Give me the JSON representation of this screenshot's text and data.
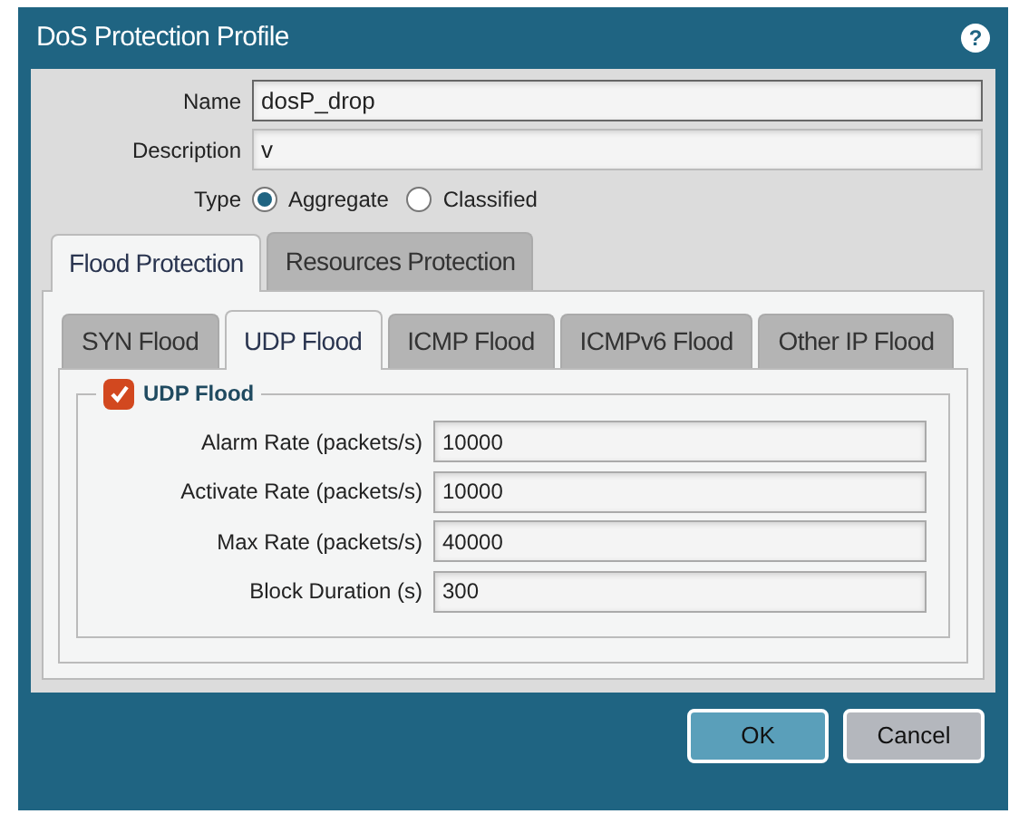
{
  "window": {
    "title": "DoS Protection Profile",
    "help": "?"
  },
  "fields": [
    {
      "label": "Name",
      "value": "dosP_drop",
      "focused": true
    },
    {
      "label": "Description",
      "value": "v",
      "focused": false
    }
  ],
  "type": {
    "label": "Type",
    "options": [
      {
        "label": "Aggregate",
        "selected": true
      },
      {
        "label": "Classified",
        "selected": false
      }
    ]
  },
  "tabs": [
    {
      "label": "Flood Protection",
      "selected": true
    },
    {
      "label": "Resources Protection",
      "selected": false
    }
  ],
  "subtabs": [
    {
      "label": "SYN Flood",
      "selected": false
    },
    {
      "label": "UDP Flood",
      "selected": true
    },
    {
      "label": "ICMP Flood",
      "selected": false
    },
    {
      "label": "ICMPv6 Flood",
      "selected": false
    },
    {
      "label": "Other IP Flood",
      "selected": false
    }
  ],
  "group": {
    "label": "UDP Flood",
    "checked": true,
    "rows": [
      {
        "label": "Alarm Rate (packets/s)",
        "value": "10000"
      },
      {
        "label": "Activate Rate (packets/s)",
        "value": "10000"
      },
      {
        "label": "Max Rate (packets/s)",
        "value": "40000"
      },
      {
        "label": "Block Duration (s)",
        "value": "300"
      }
    ]
  },
  "buttons": [
    {
      "label": "OK",
      "kind": "primary"
    },
    {
      "label": "Cancel",
      "kind": "secondary"
    }
  ]
}
